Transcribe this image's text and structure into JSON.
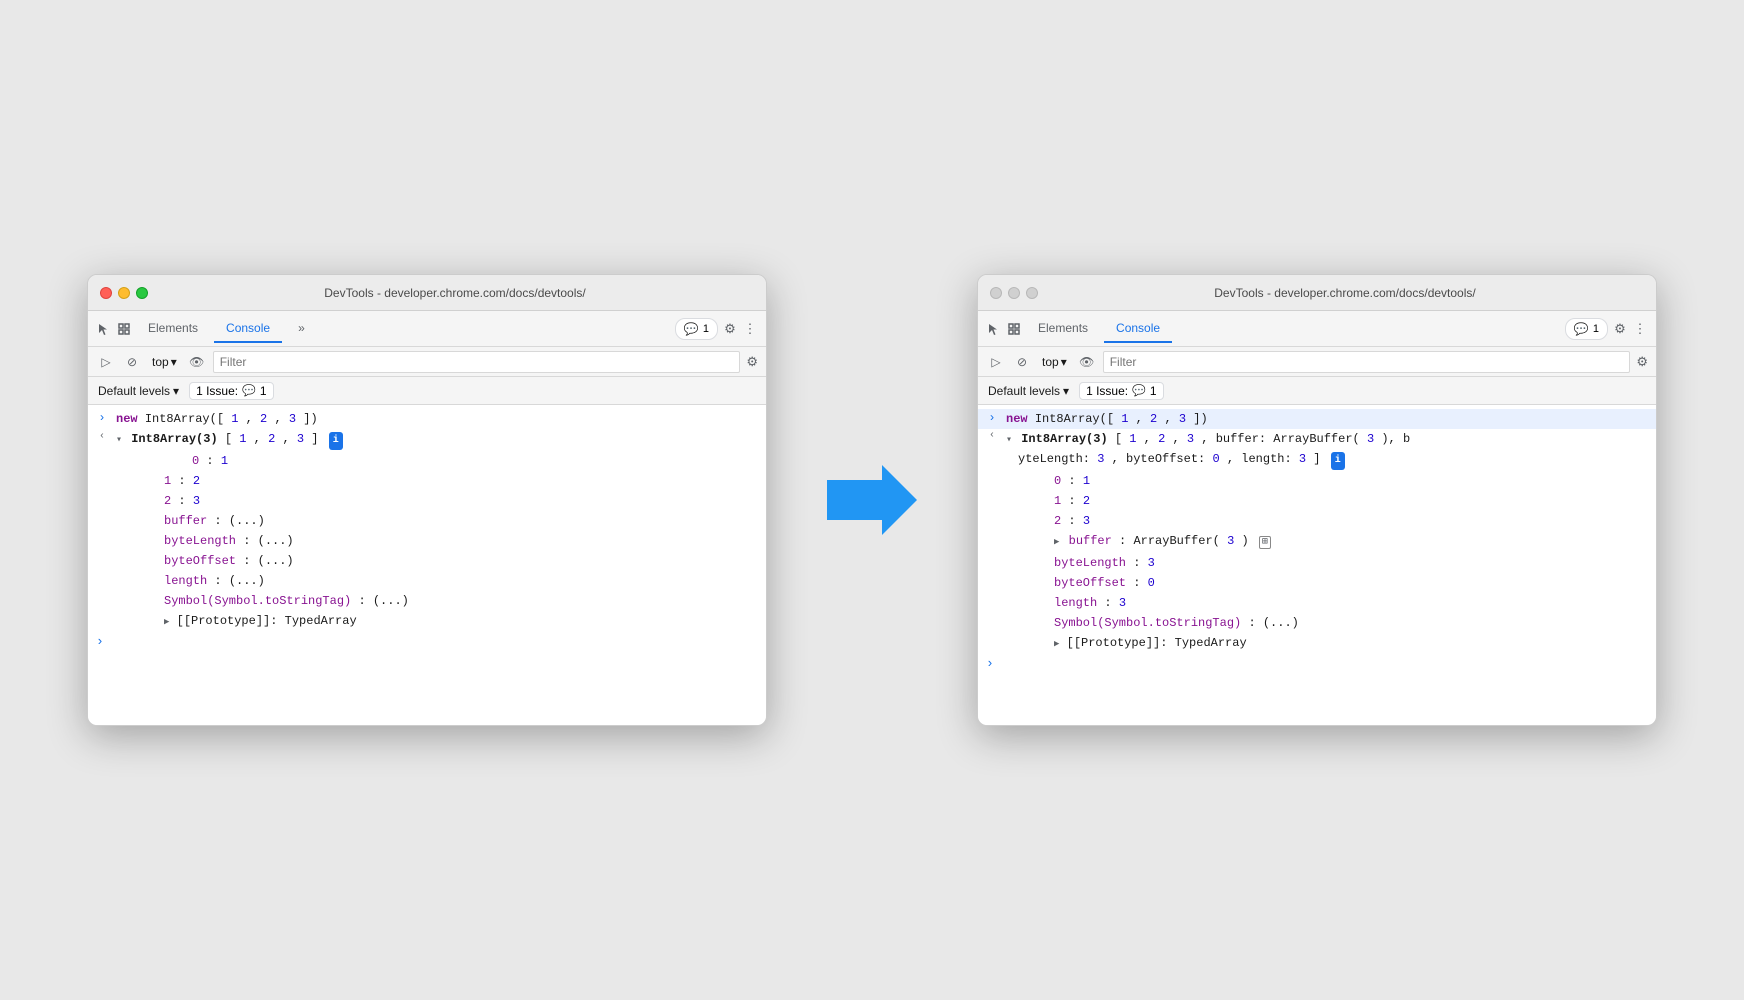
{
  "windows": [
    {
      "id": "left",
      "active": true,
      "title": "DevTools - developer.chrome.com/docs/devtools/",
      "tabs": [
        "Elements",
        "Console",
        "»"
      ],
      "activeTab": "Console",
      "badgeCount": "1",
      "consoleBars": {
        "topSelector": "top",
        "filterPlaceholder": "Filter",
        "defaultLevels": "Default levels",
        "issueCount": "1 Issue:",
        "issueNum": "1"
      },
      "consoleLines": [
        {
          "type": "input",
          "text": "new Int8Array([1,2,3])"
        },
        {
          "type": "output-expanded",
          "prefix": "Int8Array(3) [1, 2, 3]",
          "hasInfo": true
        },
        {
          "type": "prop",
          "indent": 2,
          "label": "0:",
          "value": "1"
        },
        {
          "type": "prop",
          "indent": 2,
          "label": "1:",
          "value": "2"
        },
        {
          "type": "prop",
          "indent": 2,
          "label": "2:",
          "value": "3"
        },
        {
          "type": "prop-collapsed",
          "indent": 2,
          "label": "buffer:",
          "value": "(...)"
        },
        {
          "type": "prop-collapsed",
          "indent": 2,
          "label": "byteLength:",
          "value": "(...)"
        },
        {
          "type": "prop-collapsed",
          "indent": 2,
          "label": "byteOffset:",
          "value": "(...)"
        },
        {
          "type": "prop-collapsed",
          "indent": 2,
          "label": "length:",
          "value": "(...)"
        },
        {
          "type": "prop-collapsed",
          "indent": 2,
          "label": "Symbol(Symbol.toStringTag):",
          "value": "(...)"
        },
        {
          "type": "prototype",
          "indent": 2,
          "label": "[[Prototype]]:",
          "value": "TypedArray"
        },
        {
          "type": "prompt"
        }
      ]
    },
    {
      "id": "right",
      "active": false,
      "title": "DevTools - developer.chrome.com/docs/devtools/",
      "tabs": [
        "Elements",
        "Console"
      ],
      "activeTab": "Console",
      "badgeCount": "1",
      "consoleBars": {
        "topSelector": "top",
        "filterPlaceholder": "Filter",
        "defaultLevels": "Default levels",
        "issueCount": "1 Issue:",
        "issueNum": "1"
      },
      "consoleLines": [
        {
          "type": "input",
          "text": "new Int8Array([1,2,3])",
          "highlighted": true
        },
        {
          "type": "output-expanded-full",
          "text": "Int8Array(3) [1, 2, 3, buffer: ArrayBuffer(3), b\nyteLength: 3, byteOffset: 0, length: 3]",
          "hasInfo": true,
          "redArrow": true
        },
        {
          "type": "prop",
          "indent": 2,
          "label": "0:",
          "value": "1"
        },
        {
          "type": "prop",
          "indent": 2,
          "label": "1:",
          "value": "2"
        },
        {
          "type": "prop",
          "indent": 2,
          "label": "2:",
          "value": "3"
        },
        {
          "type": "prop-expandable",
          "indent": 2,
          "label": "buffer:",
          "value": "ArrayBuffer(3)",
          "hasIcon": true,
          "redArrow": true
        },
        {
          "type": "prop-value",
          "indent": 2,
          "label": "byteLength:",
          "value": "3"
        },
        {
          "type": "prop-value",
          "indent": 2,
          "label": "byteOffset:",
          "value": "0"
        },
        {
          "type": "prop-value",
          "indent": 2,
          "label": "length:",
          "value": "3"
        },
        {
          "type": "prop-collapsed",
          "indent": 2,
          "label": "Symbol(Symbol.toStringTag):",
          "value": "(...)"
        },
        {
          "type": "prototype",
          "indent": 2,
          "label": "[[Prototype]]:",
          "value": "TypedArray"
        },
        {
          "type": "prompt"
        }
      ]
    }
  ],
  "arrow": {
    "color": "#2196f3",
    "label": "→"
  }
}
